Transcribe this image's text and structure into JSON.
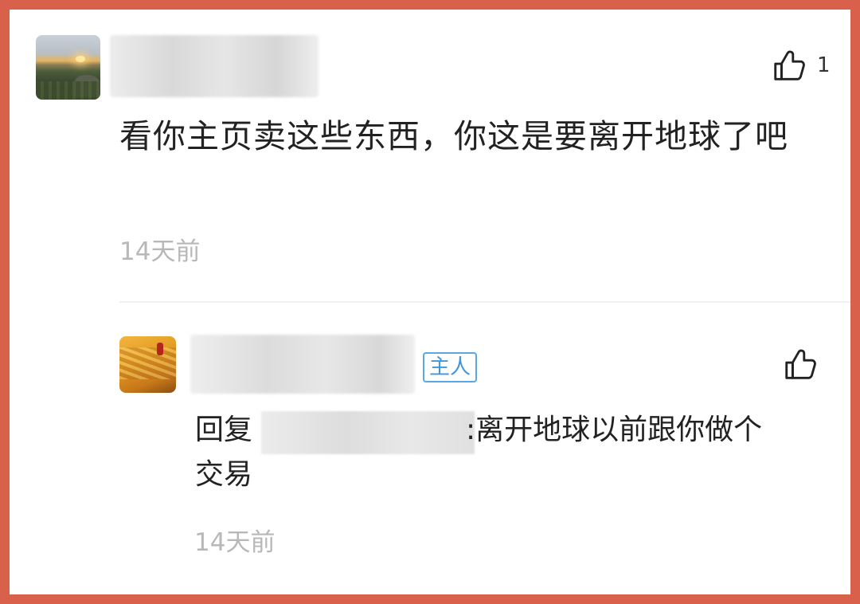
{
  "comment": {
    "avatar": "landscape-sunset-avatar",
    "username_visible": "",
    "likes": "1",
    "text": "看你主页卖这些东西，你这是要离开地球了吧",
    "time": "14天前"
  },
  "reply": {
    "avatar": "golden-field-avatar",
    "username_visible": "",
    "badge": "主人",
    "reply_prefix": "回复",
    "reply_target_visible": "",
    "text_line1": ":离开地球以前跟你做个",
    "text_line2": "交易",
    "time": "14天前"
  },
  "colors": {
    "frame": "#d9604b",
    "background": "#ffffff",
    "badge": "#3f95de",
    "time": "#b8b8b8",
    "text": "#222222"
  },
  "icons": {
    "like": "thumb-up-icon"
  }
}
